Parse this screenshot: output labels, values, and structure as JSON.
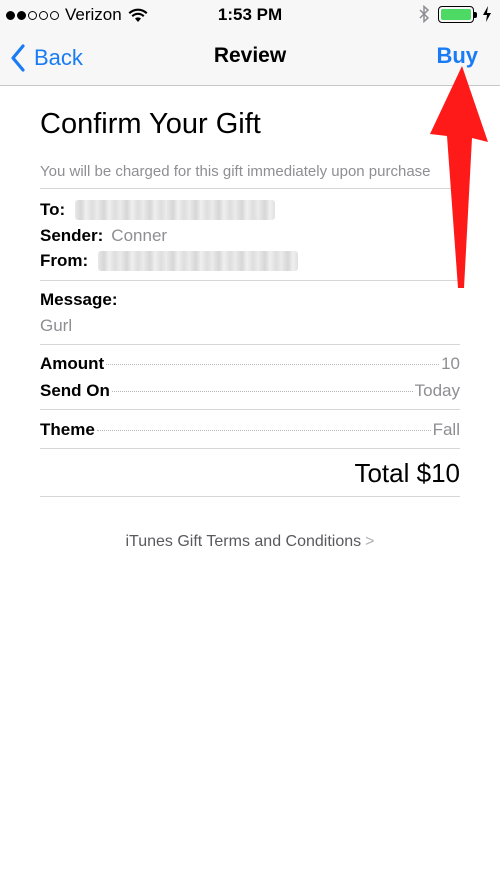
{
  "status_bar": {
    "carrier": "Verizon",
    "time": "1:53 PM",
    "signal_bars_filled": 2,
    "signal_bars_total": 5,
    "battery_fill": 1.0,
    "battery_color": "#4cd964"
  },
  "nav": {
    "back_label": "Back",
    "title": "Review",
    "buy_label": "Buy",
    "accent": "#1a7cf4"
  },
  "content": {
    "title": "Confirm Your Gift",
    "notice": "You will be charged for this gift immediately upon purchase",
    "to_label": "To:",
    "sender_label": "Sender:",
    "sender_value": "Conner",
    "from_label": "From:",
    "message_label": "Message:",
    "message_value": "Gurl",
    "amount_label": "Amount",
    "amount_value": "10",
    "send_on_label": "Send On",
    "send_on_value": "Today",
    "theme_label": "Theme",
    "theme_value": "Fall",
    "total": "Total $10",
    "terms_link": "iTunes Gift Terms and Conditions",
    "terms_chevron": ">"
  },
  "annotation": {
    "arrow_color": "#ff1a1a",
    "points_to": "buy-button"
  }
}
